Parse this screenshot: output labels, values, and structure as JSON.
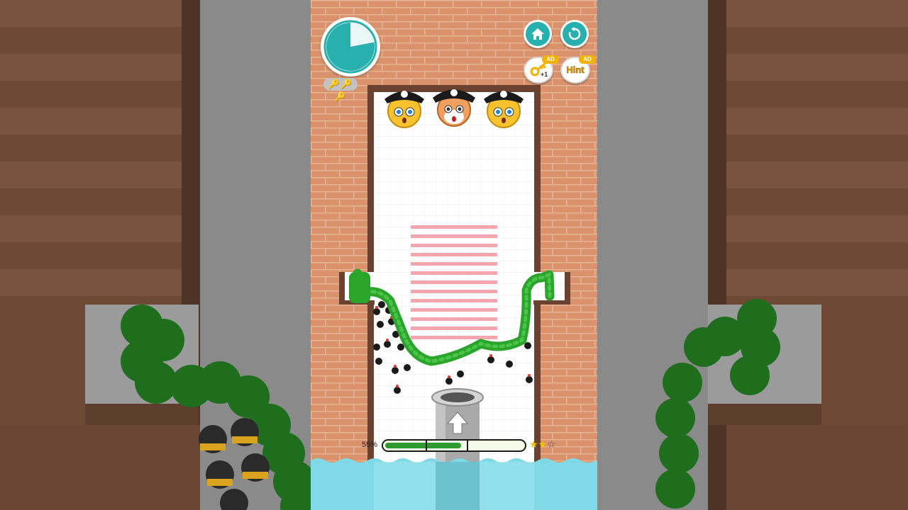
{
  "game": {
    "timer_remaining": 0.78,
    "keys_badge": "🔑🔑🔑",
    "buttons": {
      "home": {
        "icon": "home-icon"
      },
      "restart": {
        "icon": "restart-icon"
      },
      "key": {
        "icon": "key-icon",
        "ad": "AD",
        "extra": "+1"
      },
      "hint": {
        "label": "Hint",
        "ad": "AD"
      }
    },
    "progress": {
      "percent_label": "55%",
      "value": 0.55,
      "stars_filled": 2,
      "stars_total": 3
    },
    "colors": {
      "accent": "#27b0ad",
      "brick": "#d9926b",
      "mortar": "#e8b493",
      "worm": "#2aa42a",
      "water": "#7fd9e6",
      "hint_gold": "#f2b200"
    },
    "characters": [
      "pirate-cat-left",
      "pirate-fox-center",
      "pirate-cat-right"
    ]
  }
}
